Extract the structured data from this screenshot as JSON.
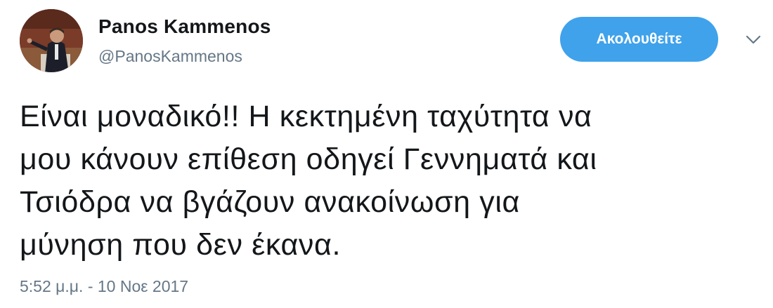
{
  "author": {
    "name": "Panos Kammenos",
    "handle": "@PanosKammenos"
  },
  "follow_button": {
    "label": "Ακολουθείτε",
    "color": "#3fa2eb"
  },
  "menu": {
    "icon": "chevron-down-icon"
  },
  "tweet": {
    "lines": [
      "Είναι μοναδικό!! Η κεκτημένη ταχύτητα να",
      "μου κάνουν επίθεση οδηγεί Γεννηματά και",
      "Τσιόδρα να βγάζουν ανακοίνωση για",
      "μύνηση που δεν έκανα."
    ]
  },
  "timestamp": "5:52 μ.μ. - 10 Νοε 2017",
  "colors": {
    "text": "#14171a",
    "secondary_text": "#657786",
    "accent": "#3fa2eb"
  }
}
